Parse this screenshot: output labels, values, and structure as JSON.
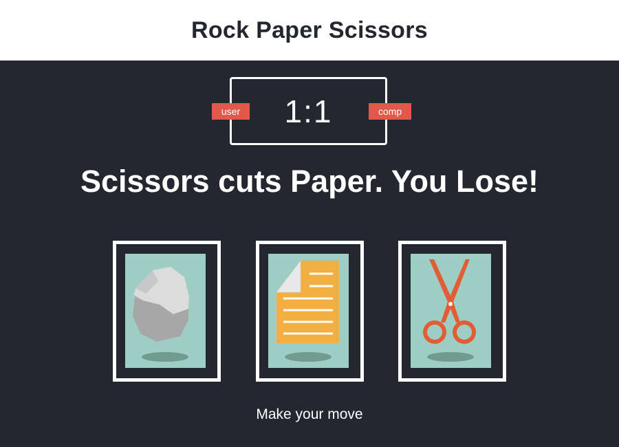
{
  "header": {
    "title": "Rock Paper Scissors"
  },
  "scoreboard": {
    "user_label": "user",
    "comp_label": "comp",
    "score": "1:1"
  },
  "result_message": "Scissors cuts Paper. You Lose!",
  "prompt": "Make your move",
  "choices": [
    {
      "id": "rock",
      "icon": "rock-icon"
    },
    {
      "id": "paper",
      "icon": "paper-icon"
    },
    {
      "id": "scissors",
      "icon": "scissors-icon"
    }
  ],
  "colors": {
    "board_bg": "#24272f",
    "badge": "#e2584d",
    "card_bg": "#9ecdc3",
    "paper": "#f1b041",
    "scissors": "#e25c35"
  }
}
